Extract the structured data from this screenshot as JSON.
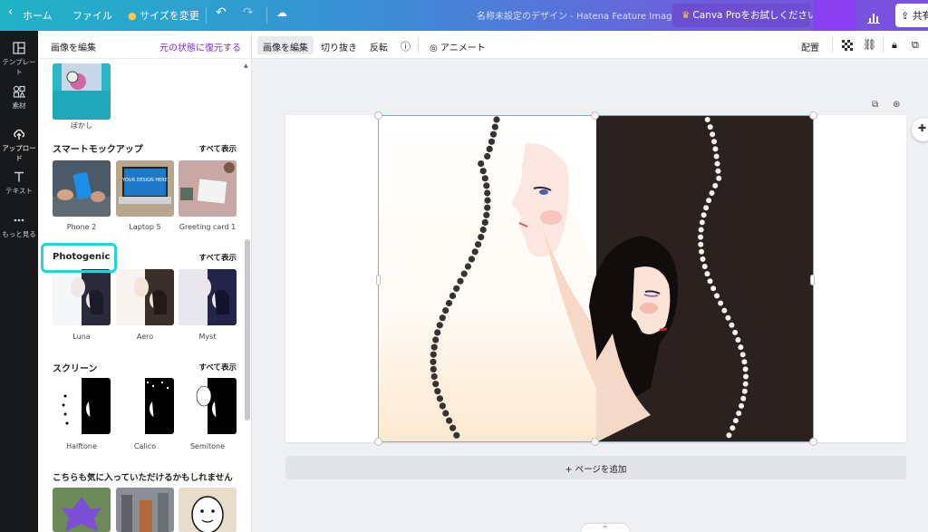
{
  "topbar": {
    "home": "ホーム",
    "file": "ファイル",
    "resize": "サイズを変更",
    "doc_title": "名称未設定のデザイン - Hatena Feature Image",
    "pro_button": "Canva Proをお試しください",
    "share": "共有"
  },
  "rail": {
    "items": [
      {
        "label": "テンプレート",
        "icon": "template-icon"
      },
      {
        "label": "素材",
        "icon": "elements-icon"
      },
      {
        "label": "アップロード",
        "icon": "upload-icon"
      },
      {
        "label": "テキスト",
        "icon": "text-icon"
      },
      {
        "label": "もっと見る",
        "icon": "more-icon"
      }
    ]
  },
  "panel": {
    "title": "画像を編集",
    "restore": "元の状態に復元する",
    "blur_label": "ぼかし",
    "sections": [
      {
        "title": "スマートモックアップ",
        "see_all": "すべて表示",
        "items": [
          "Phone 2",
          "Laptop 5",
          "Greeting card 1"
        ]
      },
      {
        "title": "Photogenic",
        "see_all": "すべて表示",
        "items": [
          "Luna",
          "Aero",
          "Myst"
        ]
      },
      {
        "title": "スクリーン",
        "see_all": "すべて表示",
        "items": [
          "Halftone",
          "Calico",
          "Semitone"
        ]
      },
      {
        "title": "こちらも気に入っていただけるかもしれません",
        "see_all": "",
        "items": []
      }
    ],
    "mockup_text": "YOUR DESIGN HERE"
  },
  "toolbar": {
    "edit_image": "画像を編集",
    "crop": "切り抜き",
    "flip": "反転",
    "animate": "アニメート",
    "position": "配置"
  },
  "canvas": {
    "add_page": "+ ページを追加"
  },
  "colors": {
    "accent_purple": "#7d2ae8",
    "selection_cyan": "#2fd0df",
    "highlight_cyan": "#22d3e6",
    "rail_bg": "#18191b"
  }
}
